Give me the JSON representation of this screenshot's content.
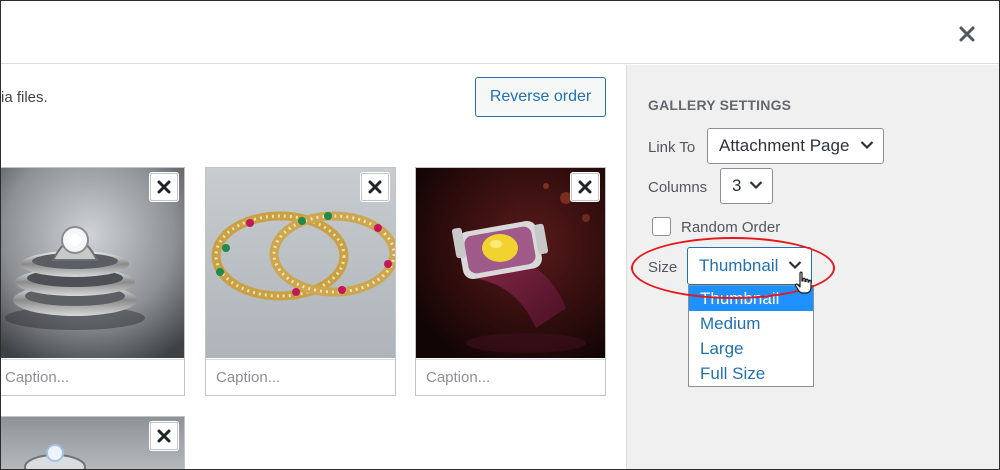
{
  "header": {
    "close_icon": "close-icon"
  },
  "main": {
    "help_text": "ia files.",
    "reverse_order_label": "Reverse order",
    "tiles": [
      {
        "caption_placeholder": "Caption...",
        "image": "rings-photo"
      },
      {
        "caption_placeholder": "Caption...",
        "image": "bangles-photo"
      },
      {
        "caption_placeholder": "Caption...",
        "image": "watch-photo"
      },
      {
        "caption_placeholder": "",
        "image": "ring-photo"
      }
    ]
  },
  "sidebar": {
    "title": "GALLERY SETTINGS",
    "link_to_label": "Link To",
    "link_to_value": "Attachment Page",
    "columns_label": "Columns",
    "columns_value": "3",
    "random_order_label": "Random Order",
    "random_order_checked": false,
    "size_label": "Size",
    "size_value": "Thumbnail",
    "size_options": [
      "Thumbnail",
      "Medium",
      "Large",
      "Full Size"
    ],
    "size_selected_index": 0
  },
  "colors": {
    "accent": "#2271b1",
    "highlight": "#1e90ff",
    "annotation": "#e5191b",
    "sidebar_bg": "#f0f0f1"
  }
}
